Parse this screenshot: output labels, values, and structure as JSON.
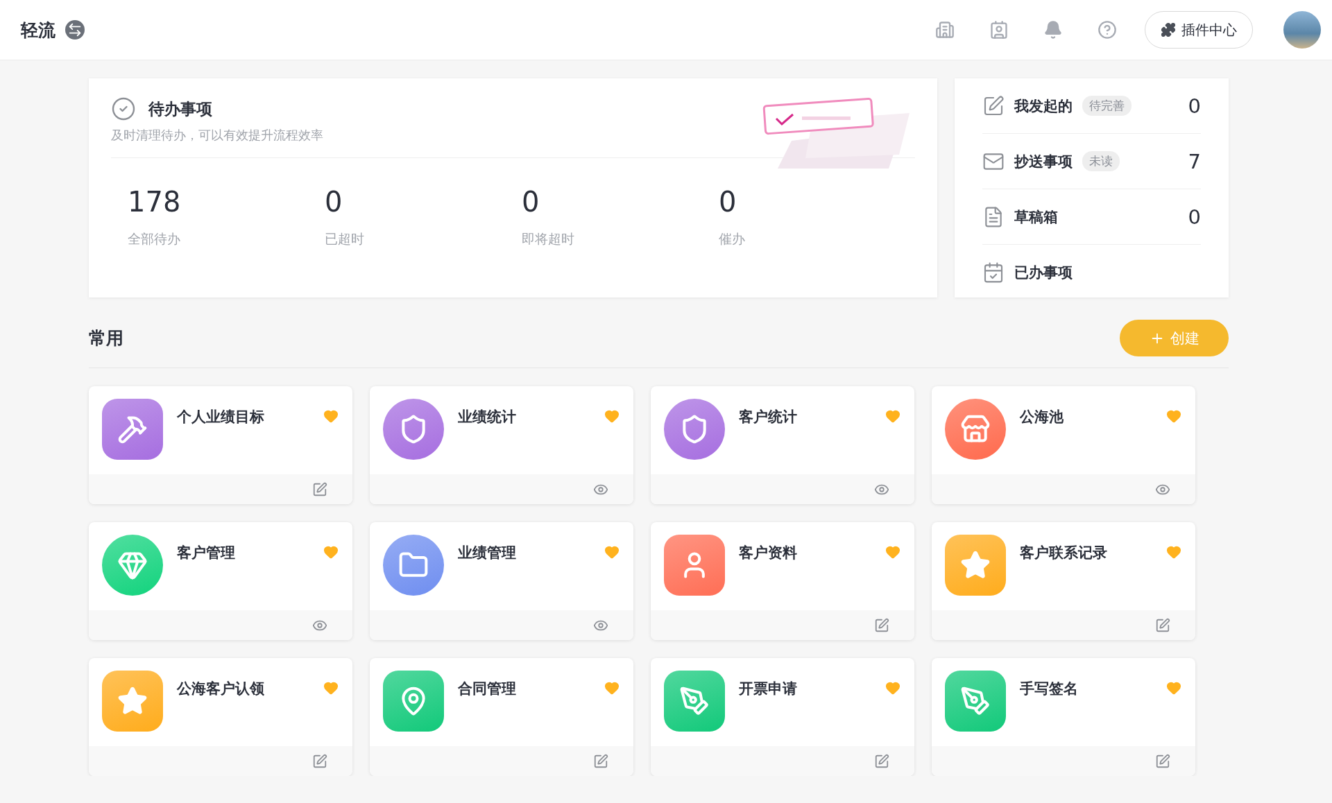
{
  "header": {
    "title": "轻流",
    "plugin_button": "插件中心"
  },
  "todo": {
    "title": "待办事项",
    "subtitle": "及时清理待办，可以有效提升流程效率",
    "stats": [
      {
        "value": "178",
        "label": "全部待办"
      },
      {
        "value": "0",
        "label": "已超时"
      },
      {
        "value": "0",
        "label": "即将超时"
      },
      {
        "value": "0",
        "label": "催办"
      }
    ]
  },
  "shortcuts": [
    {
      "kind": "started",
      "label": "我发起的",
      "badge": "待完善",
      "count": "0"
    },
    {
      "kind": "cc",
      "label": "抄送事项",
      "badge": "未读",
      "count": "7"
    },
    {
      "kind": "draft",
      "label": "草稿箱",
      "count": "0"
    },
    {
      "kind": "done",
      "label": "已办事项"
    }
  ],
  "common": {
    "title": "常用",
    "create_button": "创建"
  },
  "apps": [
    {
      "name": "个人业绩目标",
      "kind": "tools",
      "color": "#a66ee0",
      "favorite": true
    },
    {
      "name": "业绩统计",
      "kind": "shield",
      "color": "#a66ee0",
      "favorite": true
    },
    {
      "name": "客户统计",
      "kind": "shield",
      "color": "#a66ee0",
      "favorite": true
    },
    {
      "name": "公海池",
      "kind": "store",
      "color": "#ff6a4d",
      "favorite": true
    },
    {
      "name": "客户管理",
      "kind": "gem",
      "color": "#12d37d",
      "favorite": true
    },
    {
      "name": "业绩管理",
      "kind": "folder",
      "color": "#6f8ef0",
      "favorite": true
    },
    {
      "name": "客户资料",
      "kind": "user",
      "color": "#ff6e55",
      "favorite": true
    },
    {
      "name": "客户联系记录",
      "kind": "star",
      "color": "#ffac1c",
      "favorite": true
    },
    {
      "name": "公海客户认领",
      "kind": "star",
      "color": "#ffac1c",
      "favorite": true
    },
    {
      "name": "合同管理",
      "kind": "pin",
      "color": "#12c97a",
      "favorite": true
    },
    {
      "name": "开票申请",
      "kind": "pen",
      "color": "#12c97a",
      "favorite": true
    },
    {
      "name": "手写签名",
      "kind": "pen",
      "color": "#12c97a",
      "favorite": true
    }
  ]
}
